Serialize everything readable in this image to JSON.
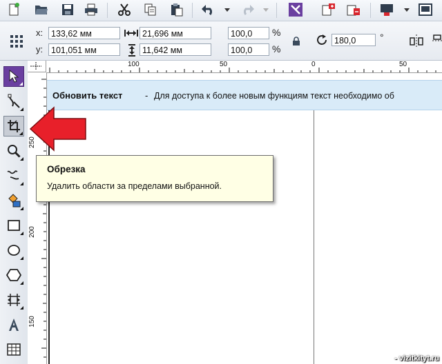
{
  "toolbar": {
    "buttons": [
      "new-document",
      "open",
      "save",
      "print",
      "cut",
      "copy",
      "paste",
      "undo",
      "redo",
      "import-launcher",
      "import",
      "export",
      "publish",
      "app-launcher"
    ]
  },
  "property_bar": {
    "x_label": "x:",
    "x_value": "133,62 мм",
    "y_label": "y:",
    "y_value": "101,051 мм",
    "width_value": "21,696 мм",
    "height_value": "11,642 мм",
    "scale_x": "100,0",
    "scale_y": "100,0",
    "percent_x": "%",
    "percent_y": "%",
    "rotation_value": "180,0",
    "degree": "°"
  },
  "rulers": {
    "horizontal_labels": [
      "100",
      "50",
      "0",
      "50"
    ],
    "vertical_labels": [
      "250",
      "200",
      "150"
    ]
  },
  "notification": {
    "title": "Обновить текст",
    "separator": "-",
    "message": "Для доступа к более новым функциям текст необходимо об"
  },
  "tooltip": {
    "title": "Обрезка",
    "description": "Удалить области за пределами выбранной."
  },
  "footer": {
    "watermark": "- vizitkityt.ru"
  },
  "colors": {
    "arrow_fill": "#e8202a",
    "notification_bg": "#d9ebf8",
    "tooltip_bg": "#ffffe5",
    "accent_purple": "#6a3fa0"
  }
}
